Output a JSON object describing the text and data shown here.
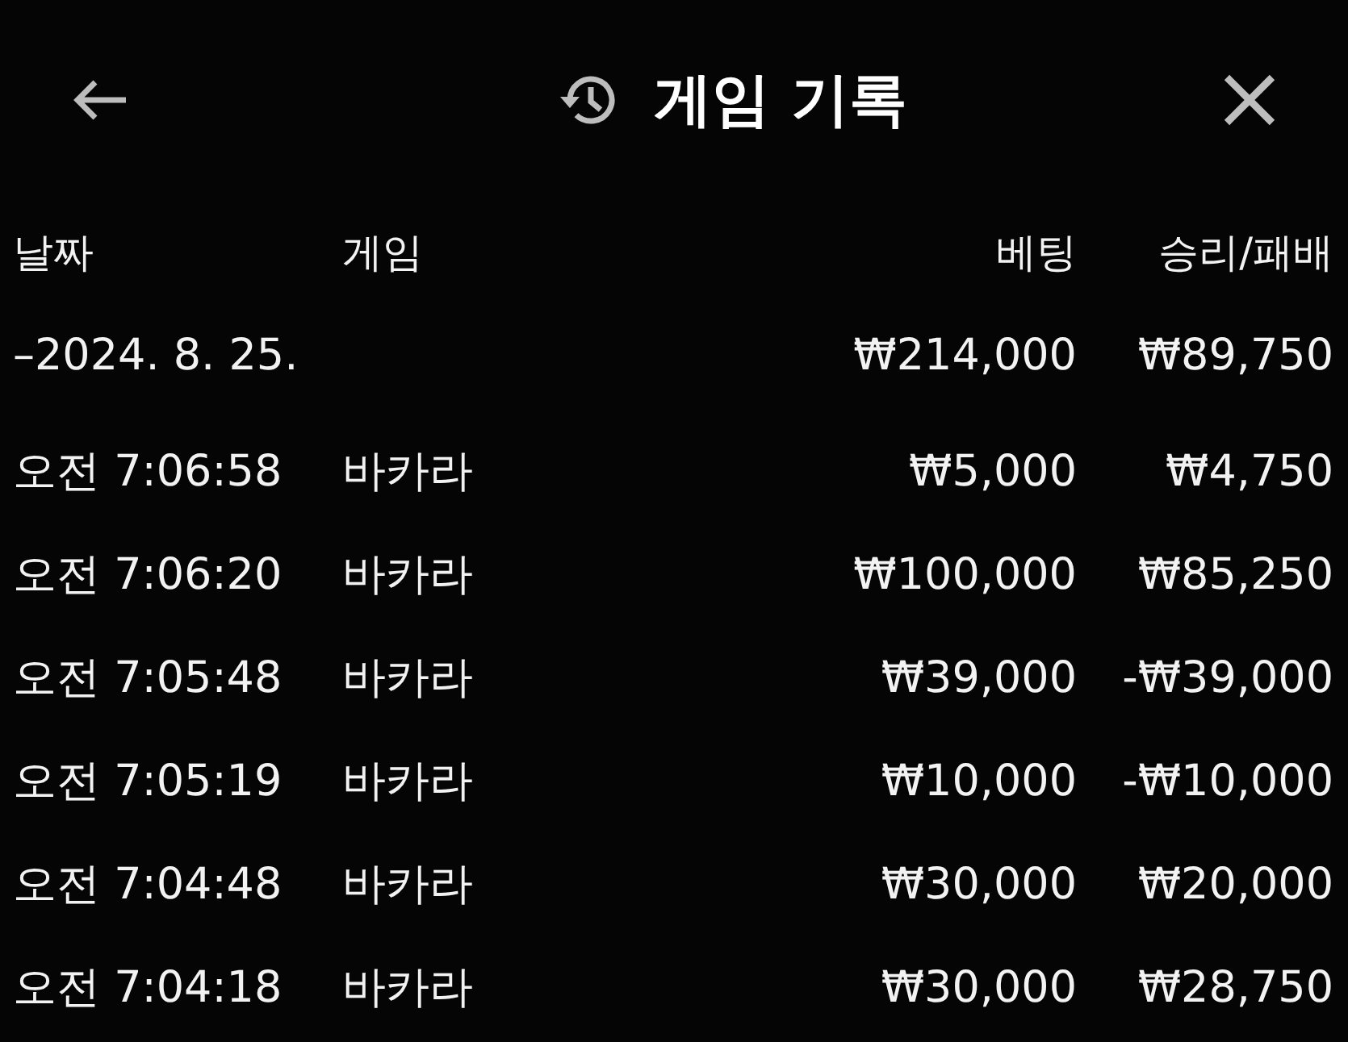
{
  "header": {
    "title": "게임 기록"
  },
  "table": {
    "columns": [
      "날짜",
      "게임",
      "베팅",
      "승리/패배"
    ],
    "groups": [
      {
        "date": "–2024. 8. 25.",
        "bet": "₩214,000",
        "result": "₩89,750",
        "rows": [
          {
            "time": "오전 7:06:58",
            "game": "바카라",
            "bet": "₩5,000",
            "result": "₩4,750"
          },
          {
            "time": "오전 7:06:20",
            "game": "바카라",
            "bet": "₩100,000",
            "result": "₩85,250"
          },
          {
            "time": "오전 7:05:48",
            "game": "바카라",
            "bet": "₩39,000",
            "result": "-₩39,000"
          },
          {
            "time": "오전 7:05:19",
            "game": "바카라",
            "bet": "₩10,000",
            "result": "-₩10,000"
          },
          {
            "time": "오전 7:04:48",
            "game": "바카라",
            "bet": "₩30,000",
            "result": "₩20,000"
          },
          {
            "time": "오전 7:04:18",
            "game": "바카라",
            "bet": "₩30,000",
            "result": "₩28,750"
          }
        ]
      }
    ]
  }
}
